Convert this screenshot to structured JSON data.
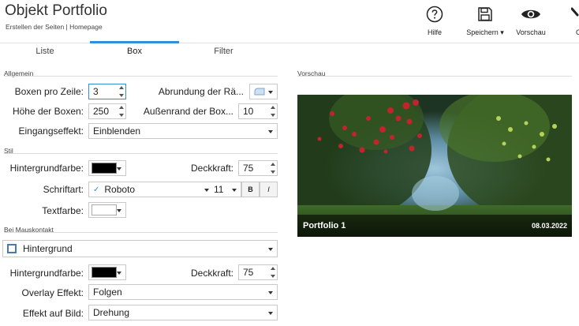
{
  "header": {
    "title": "Objekt Portfolio",
    "subtitle": "Erstellen der Seiten | Homepage",
    "tools": [
      {
        "label": "Hilfe",
        "icon": "help-icon"
      },
      {
        "label": "Speichern ▾",
        "icon": "save-icon"
      },
      {
        "label": "Vorschau",
        "icon": "eye-icon"
      },
      {
        "label": "C",
        "icon": "brush-icon"
      }
    ]
  },
  "tabs": [
    {
      "label": "Liste"
    },
    {
      "label": "Box",
      "active": true
    },
    {
      "label": "Filter"
    }
  ],
  "accent_color": "#2f8fd8",
  "sections": {
    "allgemein": "Allgemein",
    "stil": "Stil",
    "maus": "Bei Mauskontakt",
    "vorschau": "Vorschau"
  },
  "allgemein": {
    "boxen_label": "Boxen pro Zeile:",
    "boxen_value": "3",
    "abrundung_label": "Abrundung der Rä...",
    "hoehe_label": "Höhe der Boxen:",
    "hoehe_value": "250",
    "aussenrand_label": "Außenrand der Box...",
    "aussenrand_value": "10",
    "eingang_label": "Eingangseffekt:",
    "eingang_value": "Einblenden"
  },
  "stil": {
    "hg_label": "Hintergrundfarbe:",
    "hg_color": "#000000",
    "deck_label": "Deckkraft:",
    "deck_value": "75",
    "schrift_label": "Schriftart:",
    "font_check": "✓",
    "font_value": "Roboto",
    "size_value": "11",
    "bold": "B",
    "italic": "I",
    "textfarbe_label": "Textfarbe:",
    "textfarbe_color": "#ffffff"
  },
  "maus": {
    "hintergrund_label": "Hintergrund",
    "hg_label": "Hintergrundfarbe:",
    "hg_color": "#000000",
    "deck_label": "Deckkraft:",
    "deck_value": "75",
    "overlay_label": "Overlay Effekt:",
    "overlay_value": "Folgen",
    "bild_label": "Effekt auf Bild:",
    "bild_value": "Drehung"
  },
  "preview": {
    "title": "Portfolio 1",
    "date": "08.03.2022"
  }
}
